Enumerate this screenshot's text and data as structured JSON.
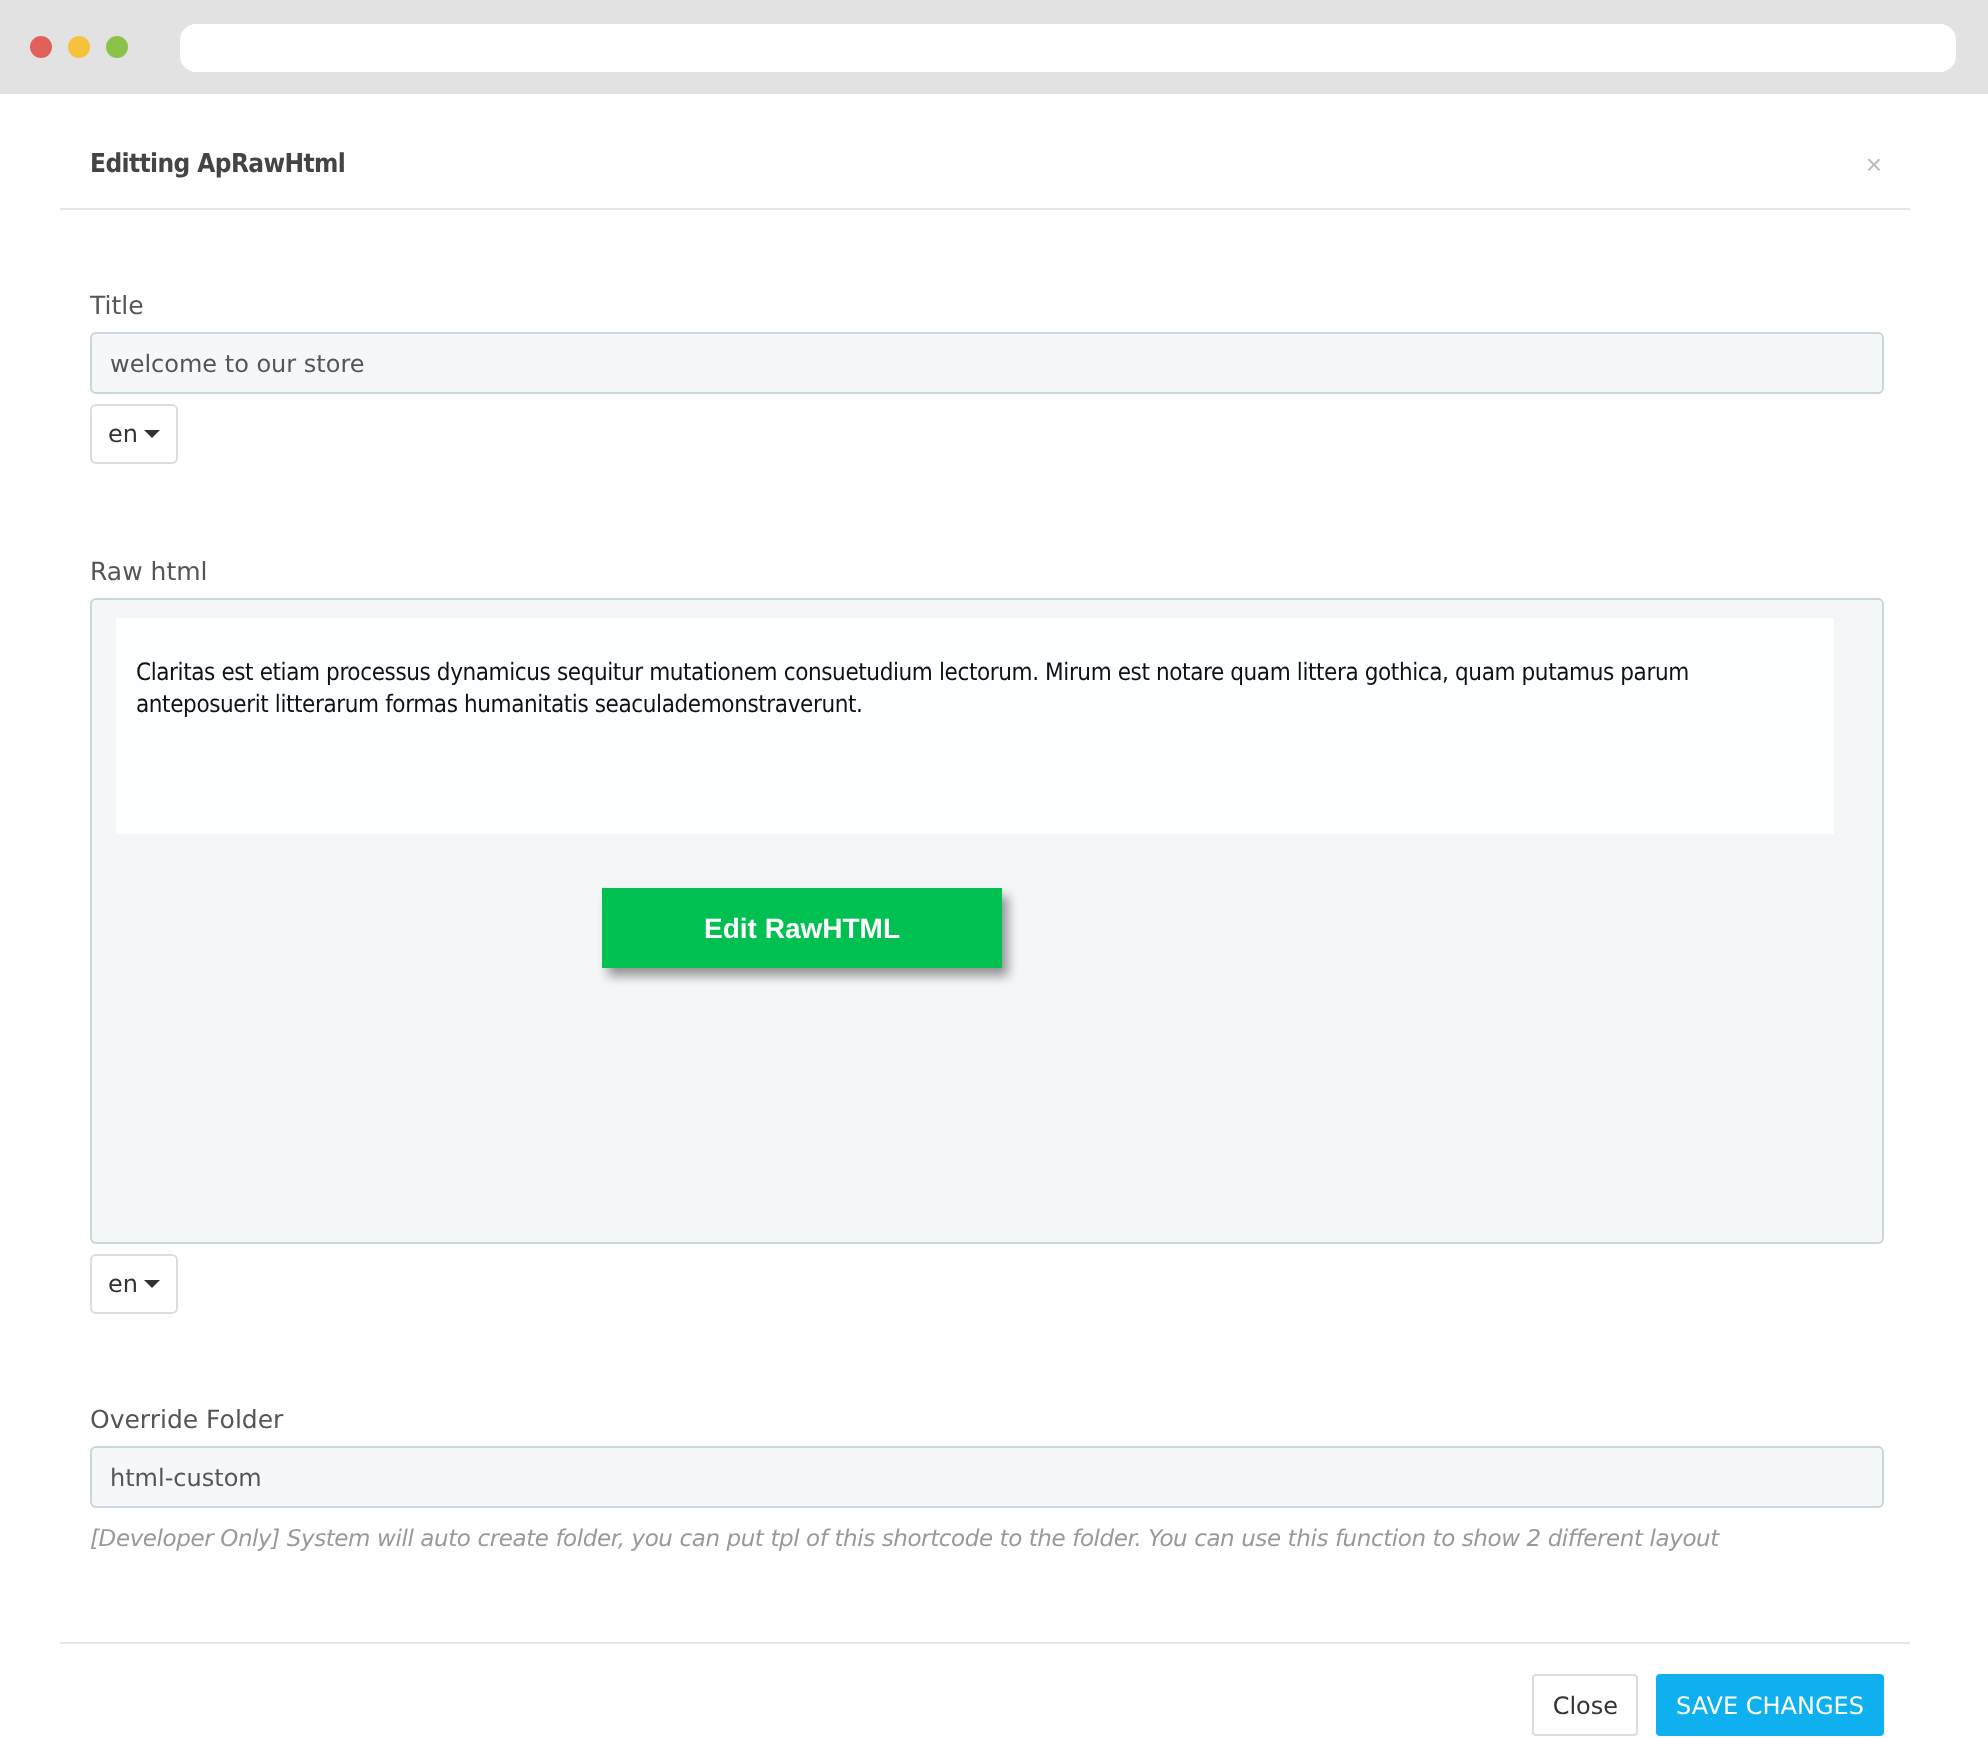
{
  "dialog": {
    "title": "Editting ApRawHtml",
    "close": "×"
  },
  "title_field": {
    "label": "Title",
    "value": "welcome to our store",
    "language": "en"
  },
  "raw_html": {
    "label": "Raw html",
    "content": "Claritas est etiam processus dynamicus sequitur mutationem consuetudium lectorum. Mirum est notare quam littera gothica, quam putamus parum anteposuerit litterarum formas humanitatis seaculademonstraverunt.",
    "edit_button": "Edit RawHTML",
    "language": "en"
  },
  "override_folder": {
    "label": "Override Folder",
    "value": "html-custom",
    "help": "[Developer Only] System will auto create folder, you can put tpl of this shortcode to the folder. You can use this function to show 2 different layout"
  },
  "buttons": [
    {
      "label": "Close",
      "kind": "default"
    },
    {
      "label": "SAVE CHANGES",
      "kind": "primary"
    }
  ]
}
